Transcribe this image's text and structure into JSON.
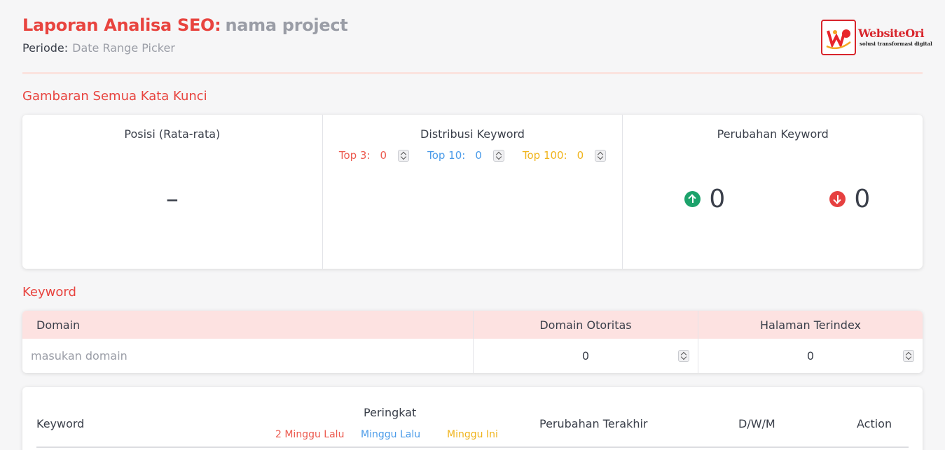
{
  "header": {
    "title": "Laporan Analisa SEO:",
    "project": "nama project",
    "period_label": "Periode:",
    "period_value": "Date Range Picker"
  },
  "logo": {
    "brand": "WebsiteOri",
    "tagline": "solusi transformasi digital"
  },
  "overview": {
    "title": "Gambaran Semua Kata Kunci",
    "avg_label": "Posisi (Rata-rata)",
    "avg_value": "–",
    "dist_label": "Distribusi Keyword",
    "top3_label": "Top 3:",
    "top3_value": "0",
    "top10_label": "Top 10:",
    "top10_value": "0",
    "top100_label": "Top 100:",
    "top100_value": "0",
    "change_label": "Perubahan Keyword",
    "up_value": "0",
    "down_value": "0"
  },
  "keyword": {
    "title": "Keyword",
    "headers": [
      "Domain",
      "Domain Otoritas",
      "Halaman Terindex"
    ],
    "domain_placeholder": "masukan domain",
    "authority_value": "0",
    "indexed_value": "0"
  },
  "ranking": {
    "keyword_col": "Keyword",
    "rank_col": "Peringkat",
    "two_weeks": "2 Minggu Lalu",
    "last_week": "Minggu Lalu",
    "this_week": "Minggu Ini",
    "last_change": "Perubahan Terakhir",
    "dwm": "D/W/M",
    "action": "Action"
  },
  "colors": {
    "accent": "#e8443f",
    "up": "#1ca26b",
    "down": "#e64040",
    "blue": "#4a9be9",
    "yellow": "#f0b41c"
  }
}
